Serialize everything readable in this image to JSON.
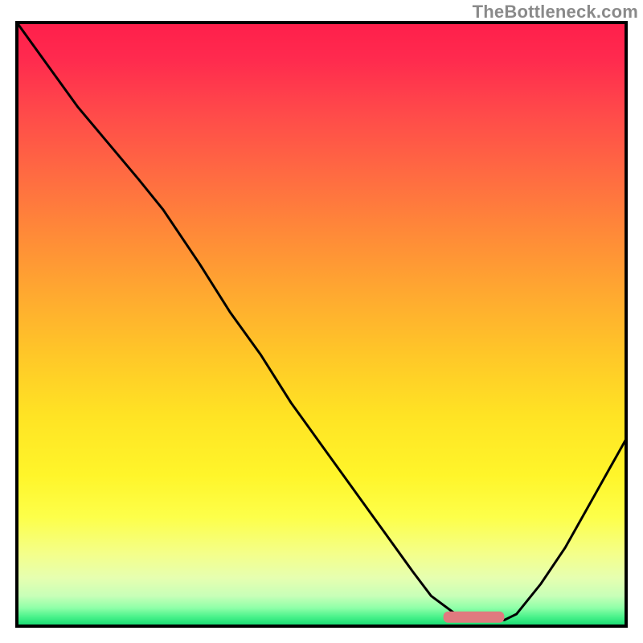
{
  "attribution": "TheBottleneck.com",
  "chart_data": {
    "type": "line",
    "title": "",
    "xlabel": "",
    "ylabel": "",
    "xlim": [
      0,
      100
    ],
    "ylim": [
      0,
      100
    ],
    "grid": false,
    "legend": false,
    "annotations": [],
    "series": [
      {
        "name": "bottleneck-curve",
        "x": [
          0,
          5,
          10,
          15,
          20,
          24,
          30,
          35,
          40,
          45,
          50,
          55,
          60,
          65,
          68,
          72,
          76,
          80,
          82,
          86,
          90,
          95,
          100
        ],
        "values": [
          100,
          93,
          86,
          80,
          74,
          69,
          60,
          52,
          45,
          37,
          30,
          23,
          16,
          9,
          5,
          2,
          1,
          1,
          2,
          7,
          13,
          22,
          31
        ]
      }
    ],
    "optimal_marker": {
      "x_range": [
        70,
        80
      ],
      "y": 1.5,
      "color": "#e07a7f"
    },
    "background_gradient_stops": [
      {
        "offset": 0.0,
        "color": "#ff1f4b"
      },
      {
        "offset": 0.06,
        "color": "#ff2a4e"
      },
      {
        "offset": 0.15,
        "color": "#ff4a4a"
      },
      {
        "offset": 0.25,
        "color": "#ff6a42"
      },
      {
        "offset": 0.35,
        "color": "#ff8a38"
      },
      {
        "offset": 0.45,
        "color": "#ffa930"
      },
      {
        "offset": 0.55,
        "color": "#ffc728"
      },
      {
        "offset": 0.65,
        "color": "#ffe324"
      },
      {
        "offset": 0.75,
        "color": "#fff52a"
      },
      {
        "offset": 0.82,
        "color": "#fdff4a"
      },
      {
        "offset": 0.88,
        "color": "#f4ff8a"
      },
      {
        "offset": 0.92,
        "color": "#e6ffb0"
      },
      {
        "offset": 0.95,
        "color": "#c8ffb8"
      },
      {
        "offset": 0.97,
        "color": "#8effa8"
      },
      {
        "offset": 0.985,
        "color": "#48f28a"
      },
      {
        "offset": 1.0,
        "color": "#13d96f"
      }
    ],
    "border_color": "#000000",
    "line_color": "#000000"
  }
}
